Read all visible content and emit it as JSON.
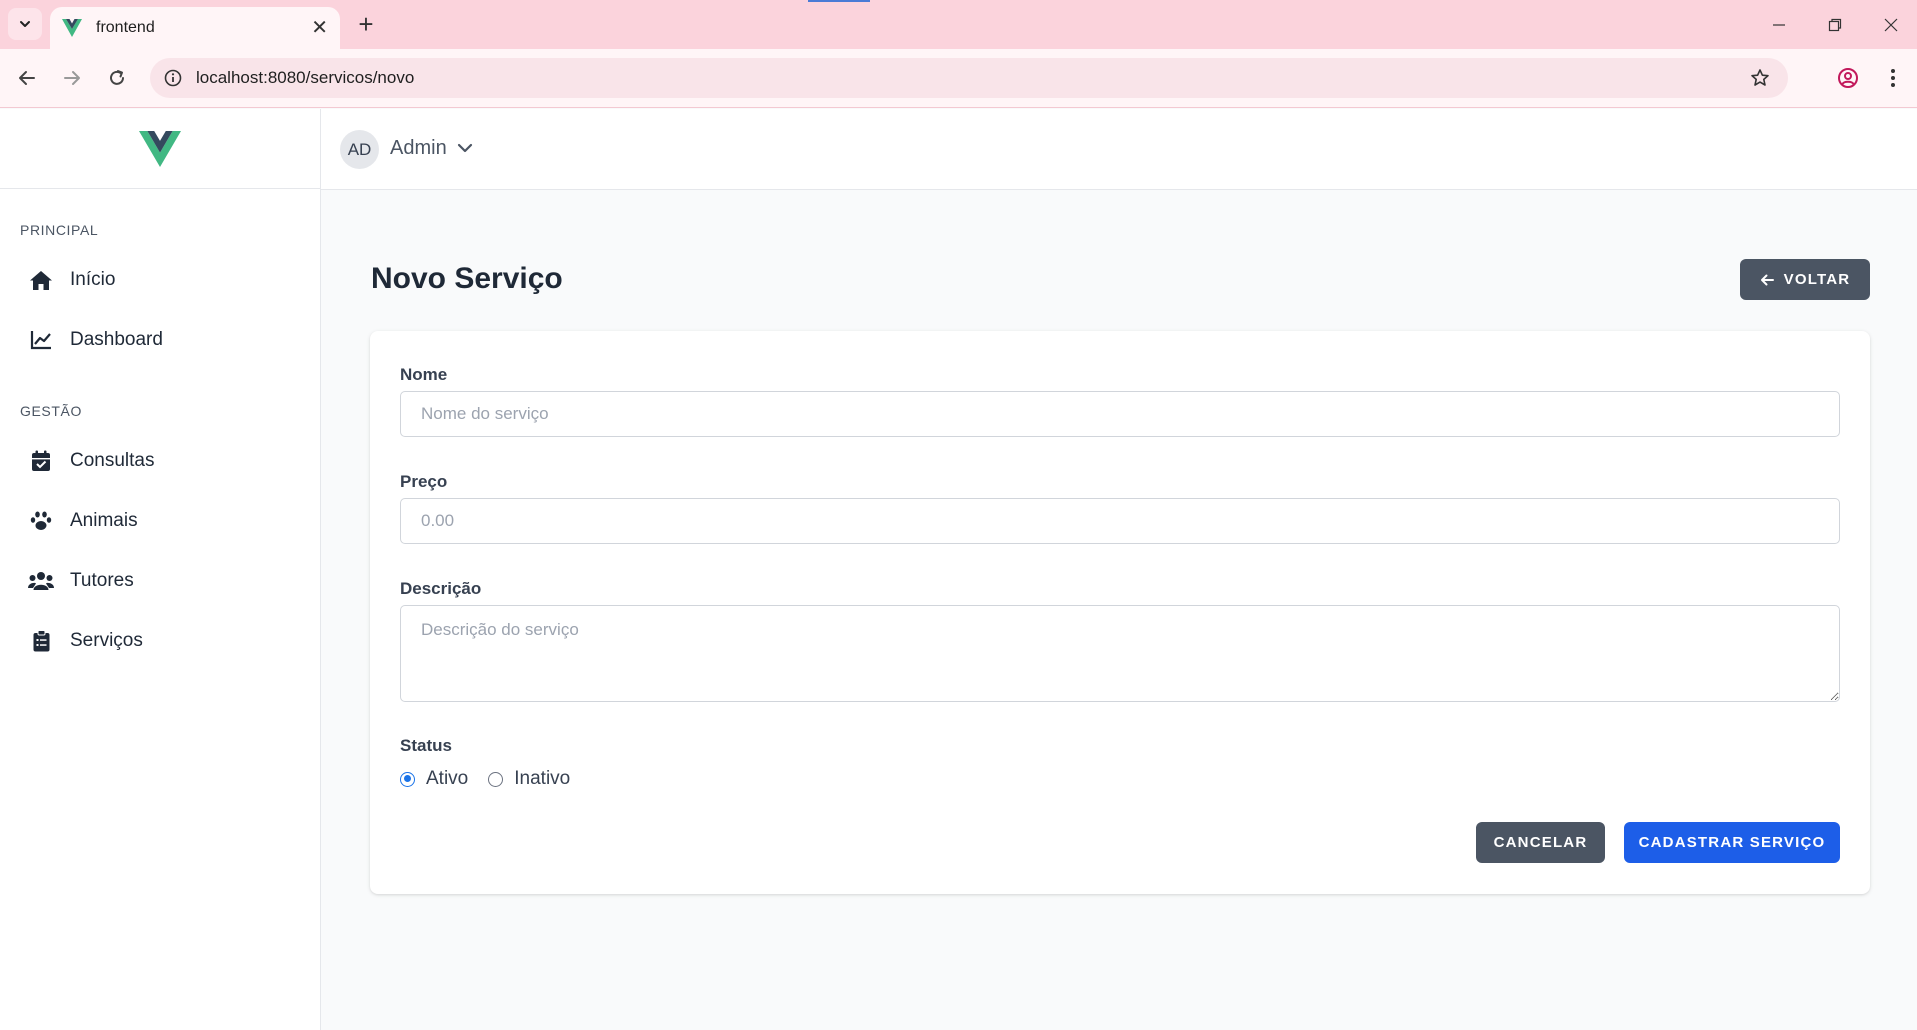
{
  "browser": {
    "tab_title": "frontend",
    "url": "localhost:8080/servicos/novo"
  },
  "colors": {
    "accent_blue": "#1d5ee8",
    "dark_button": "#4b5563",
    "vue_green": "#41b883",
    "vue_dark": "#34495e",
    "chrome_pink": "#fbd3dc"
  },
  "sidebar": {
    "sections": [
      {
        "title": "PRINCIPAL",
        "items": [
          {
            "label": "Início",
            "icon": "home-icon"
          },
          {
            "label": "Dashboard",
            "icon": "chart-line-icon"
          }
        ]
      },
      {
        "title": "GESTÃO",
        "items": [
          {
            "label": "Consultas",
            "icon": "calendar-check-icon"
          },
          {
            "label": "Animais",
            "icon": "paw-icon"
          },
          {
            "label": "Tutores",
            "icon": "users-icon"
          },
          {
            "label": "Serviços",
            "icon": "clipboard-list-icon"
          }
        ]
      }
    ]
  },
  "topbar": {
    "avatar_initials": "AD",
    "user_name": "Admin"
  },
  "page": {
    "title": "Novo Serviço",
    "back_label": "VOLTAR"
  },
  "form": {
    "nome": {
      "label": "Nome",
      "placeholder": "Nome do serviço",
      "value": ""
    },
    "preco": {
      "label": "Preço",
      "placeholder": "0.00",
      "value": ""
    },
    "descricao": {
      "label": "Descrição",
      "placeholder": "Descrição do serviço",
      "value": ""
    },
    "status": {
      "label": "Status",
      "options": [
        "Ativo",
        "Inativo"
      ],
      "selected": "Ativo"
    },
    "cancel_label": "CANCELAR",
    "submit_label": "CADASTRAR SERVIÇO"
  }
}
